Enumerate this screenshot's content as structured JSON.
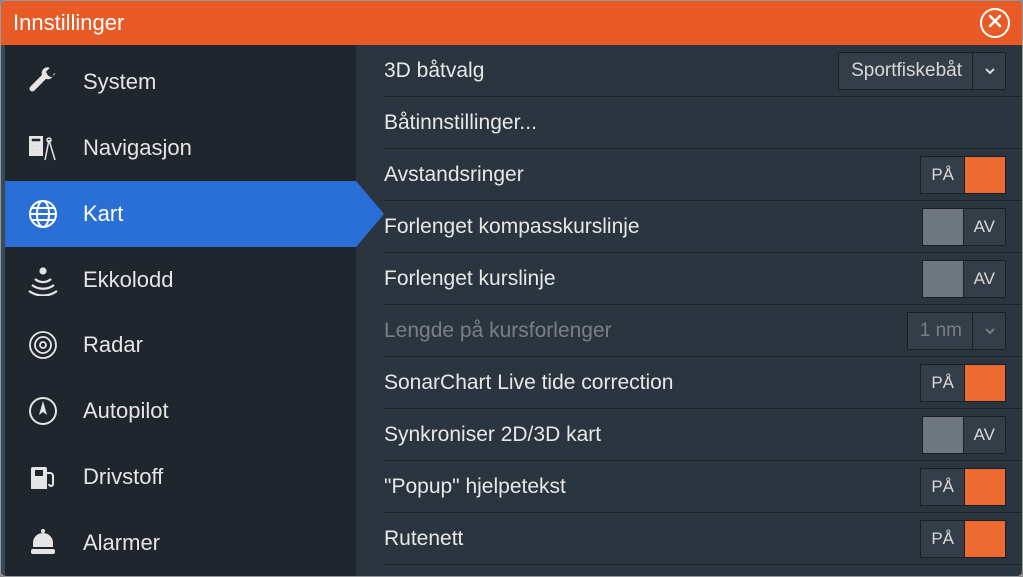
{
  "title": "Innstillinger",
  "sidebar": {
    "items": [
      {
        "label": "System"
      },
      {
        "label": "Navigasjon"
      },
      {
        "label": "Kart"
      },
      {
        "label": "Ekkolodd"
      },
      {
        "label": "Radar"
      },
      {
        "label": "Autopilot"
      },
      {
        "label": "Drivstoff"
      },
      {
        "label": "Alarmer"
      }
    ]
  },
  "content": {
    "boat3d_label": "3D båtvalg",
    "boat3d_value": "Sportfiskebåt",
    "boat_settings": "Båtinnstillinger...",
    "range_rings": "Avstandsringer",
    "ext_heading": "Forlenget kompasskurslinje",
    "ext_course": "Forlenget kurslinje",
    "ext_length_label": "Lengde på kursforlenger",
    "ext_length_value": "1 nm",
    "sonarchart": "SonarChart Live tide correction",
    "sync2d3d": "Synkroniser 2D/3D kart",
    "popup": "\"Popup\" hjelpetekst",
    "grid": "Rutenett",
    "on": "PÅ",
    "off": "AV"
  }
}
